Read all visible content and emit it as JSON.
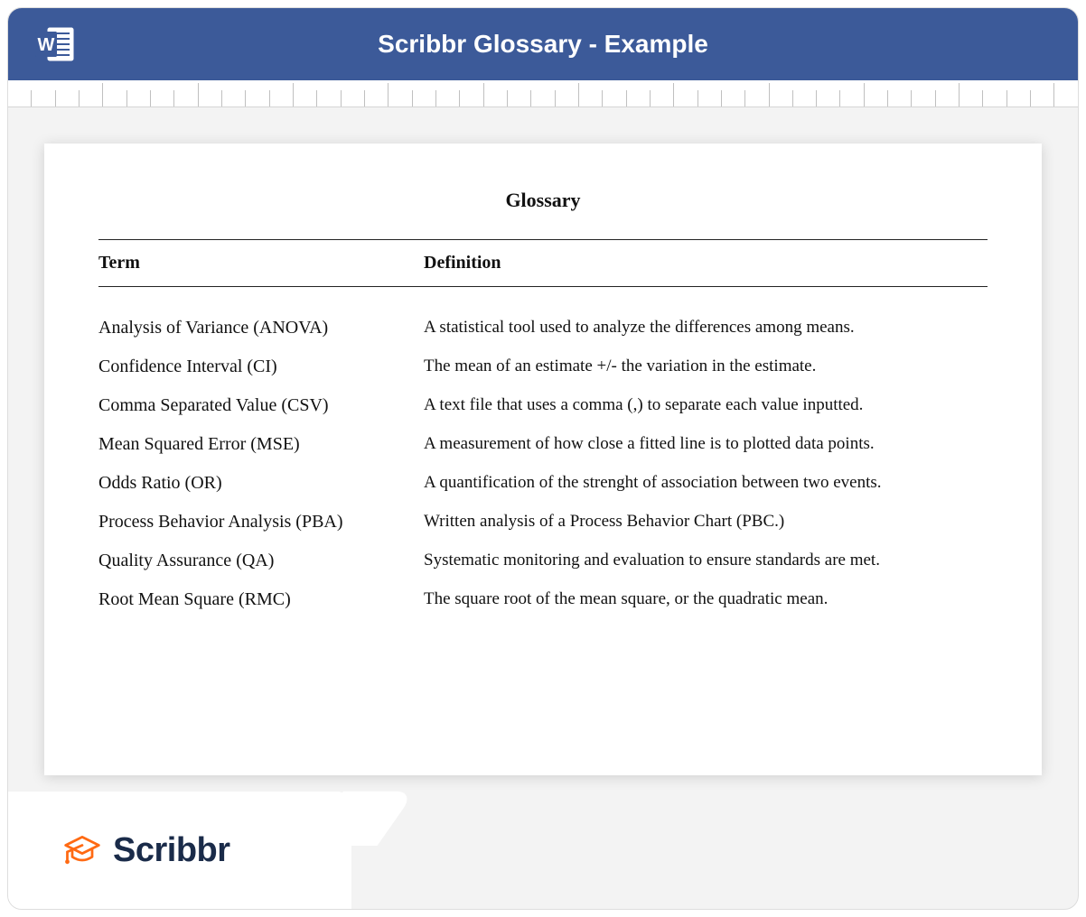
{
  "header": {
    "title": "Scribbr Glossary - Example"
  },
  "document": {
    "title": "Glossary",
    "columns": {
      "term": "Term",
      "definition": "Definition"
    },
    "rows": [
      {
        "term": "Analysis of Variance (ANOVA)",
        "definition": "A statistical tool used to analyze the differences among means."
      },
      {
        "term": "Confidence Interval (CI)",
        "definition": "The mean of an estimate +/- the variation in the estimate."
      },
      {
        "term": "Comma Separated Value (CSV)",
        "definition": "A text file that uses a comma (,) to separate each value inputted."
      },
      {
        "term": "Mean Squared Error (MSE)",
        "definition": "A measurement of how close a fitted line is to plotted data points."
      },
      {
        "term": "Odds Ratio (OR)",
        "definition": "A quantification of the strenght of association between two events."
      },
      {
        "term": "Process Behavior Analysis (PBA)",
        "definition": "Written analysis of a Process Behavior Chart (PBC.)"
      },
      {
        "term": "Quality Assurance (QA)",
        "definition": "Systematic monitoring and evaluation to ensure standards are met."
      },
      {
        "term": "Root Mean Square (RMC)",
        "definition": "The square root of the mean square, or the quadratic mean."
      }
    ]
  },
  "logo": {
    "brand": "Scribbr"
  }
}
